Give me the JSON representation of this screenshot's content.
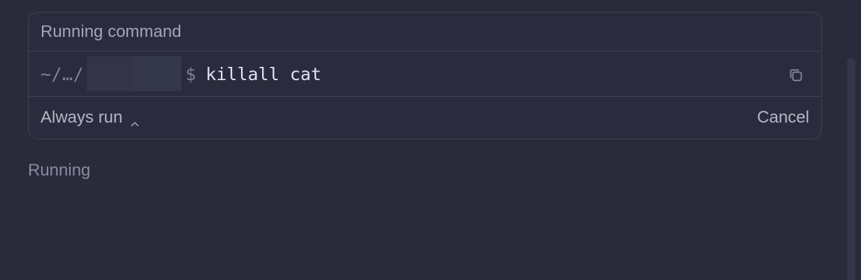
{
  "card": {
    "title": "Running command",
    "cwd": "~/…/",
    "prompt_symbol": "$",
    "command": "killall cat",
    "footer": {
      "always_run_label": "Always run",
      "cancel_label": "Cancel"
    }
  },
  "status_text": "Running",
  "icons": {
    "copy": "copy-icon",
    "chevron": "chevron-up-icon"
  },
  "colors": {
    "background": "#292b3b",
    "border": "#3f4254",
    "command_text": "#dfe2f4",
    "muted_text": "#a3a6b8"
  }
}
